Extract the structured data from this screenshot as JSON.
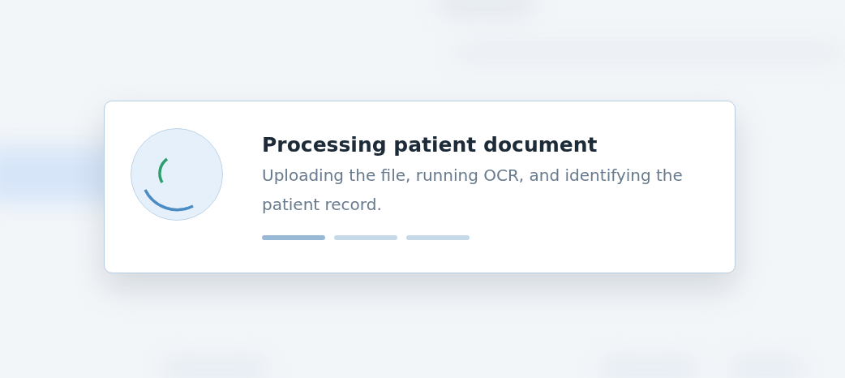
{
  "dialog": {
    "title": "Processing patient document",
    "message": "Uploading the file, running OCR, and identifying the patient record.",
    "progress_steps": [
      {
        "active": true
      },
      {
        "active": false
      },
      {
        "active": false
      }
    ]
  }
}
